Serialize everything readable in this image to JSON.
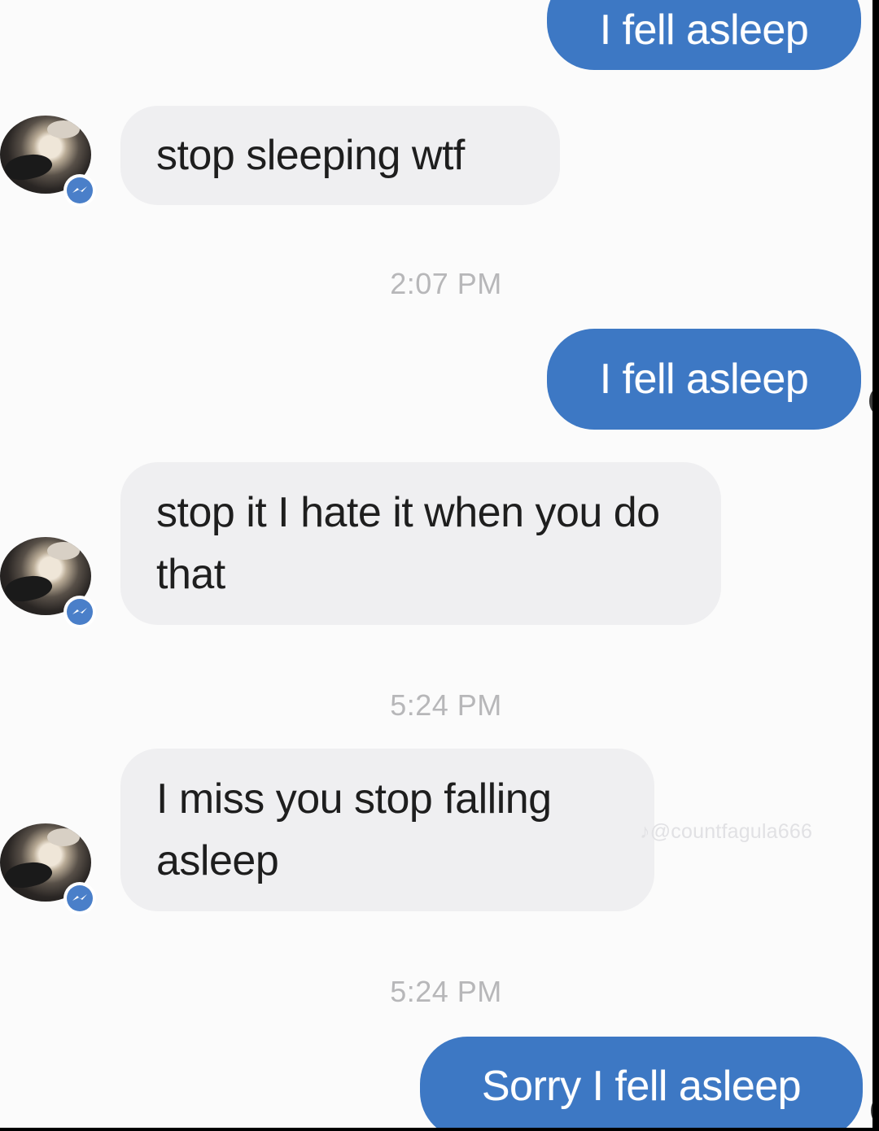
{
  "conversation": {
    "messages": [
      {
        "direction": "sent",
        "text": "I fell asleep"
      },
      {
        "direction": "received",
        "text": "stop sleeping wtf"
      },
      {
        "direction": "timestamp",
        "text": "2:07 PM"
      },
      {
        "direction": "sent",
        "text": "I fell asleep"
      },
      {
        "direction": "received",
        "text": "stop it I hate it when you do that"
      },
      {
        "direction": "timestamp",
        "text": "5:24 PM"
      },
      {
        "direction": "received",
        "text": "I miss you stop falling asleep"
      },
      {
        "direction": "timestamp",
        "text": "5:24 PM"
      },
      {
        "direction": "sent",
        "text": "Sorry I fell asleep"
      }
    ]
  },
  "watermark": {
    "text": "@countfagula666",
    "icon": "tiktok-icon"
  },
  "icons": {
    "avatar_badge": "messenger-icon"
  },
  "colors": {
    "sent_bubble": "#3d78c4",
    "received_bubble": "#efeff1",
    "background": "#fbfbfb",
    "timestamp": "#b7b7b9",
    "messenger_badge": "#4a7fc9"
  }
}
